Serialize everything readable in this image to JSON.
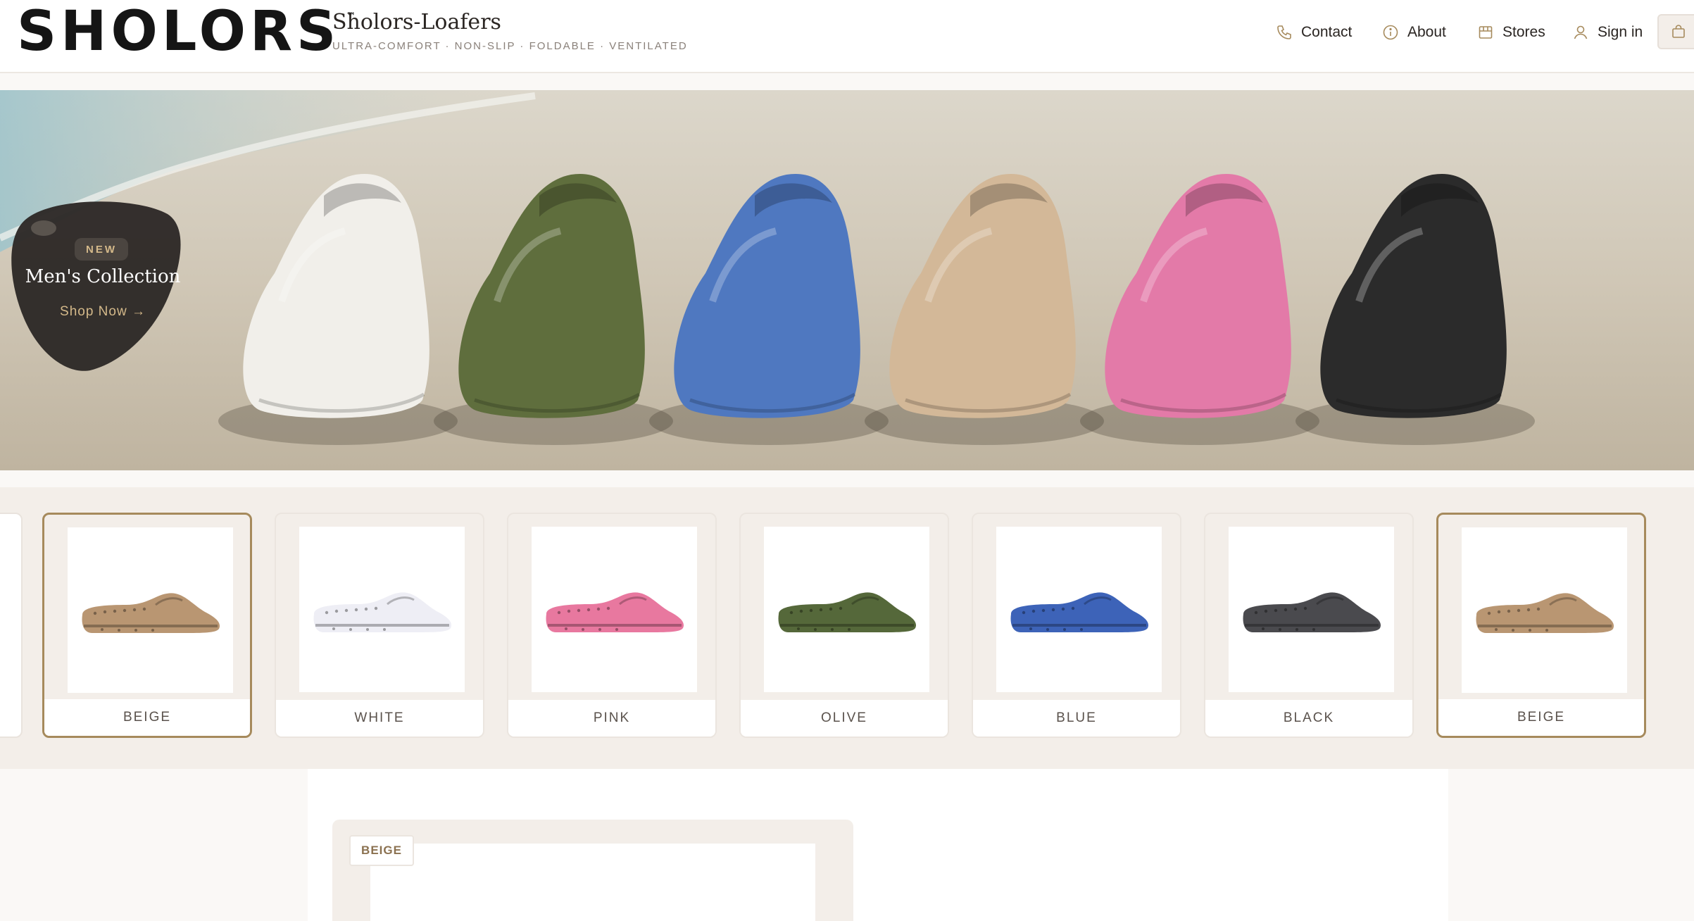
{
  "brand": {
    "logo": "SHOLORS",
    "trademark": "™",
    "name": "Sholors-Loafers",
    "tagline": "ULTRA-COMFORT · NON-SLIP · FOLDABLE · VENTILATED"
  },
  "nav": {
    "contact": {
      "label": "Contact",
      "icon": "phone-icon"
    },
    "about": {
      "label": "About",
      "icon": "info-icon"
    },
    "stores": {
      "label": "Stores",
      "icon": "store-icon"
    },
    "signin": {
      "label": "Sign in",
      "icon": "user-icon"
    },
    "cart": {
      "icon": "shopping-bag-icon"
    }
  },
  "hero": {
    "badge": "NEW",
    "title": "Men's Collection",
    "cta": "Shop Now →",
    "shoe_colors": [
      "#f1efea",
      "#5f6e3d",
      "#4f78c0",
      "#d3b898",
      "#e37aa8",
      "#2b2b2b"
    ]
  },
  "swatches": [
    {
      "label": "BEIGE",
      "color": "#b99672",
      "selected": true
    },
    {
      "label": "WHITE",
      "color": "#eeeef5",
      "selected": false
    },
    {
      "label": "PINK",
      "color": "#e8789f",
      "selected": false
    },
    {
      "label": "OLIVE",
      "color": "#55683a",
      "selected": false
    },
    {
      "label": "BLUE",
      "color": "#3d63b8",
      "selected": false
    },
    {
      "label": "BLACK",
      "color": "#4a4a4e",
      "selected": false
    },
    {
      "label": "BEIGE",
      "color": "#b99672",
      "selected": true
    }
  ],
  "preview": {
    "chip": "BEIGE"
  },
  "colors": {
    "accent": "#a68a5c",
    "promo_bg": "#2d2926",
    "panel_bg": "#f3eee9"
  }
}
